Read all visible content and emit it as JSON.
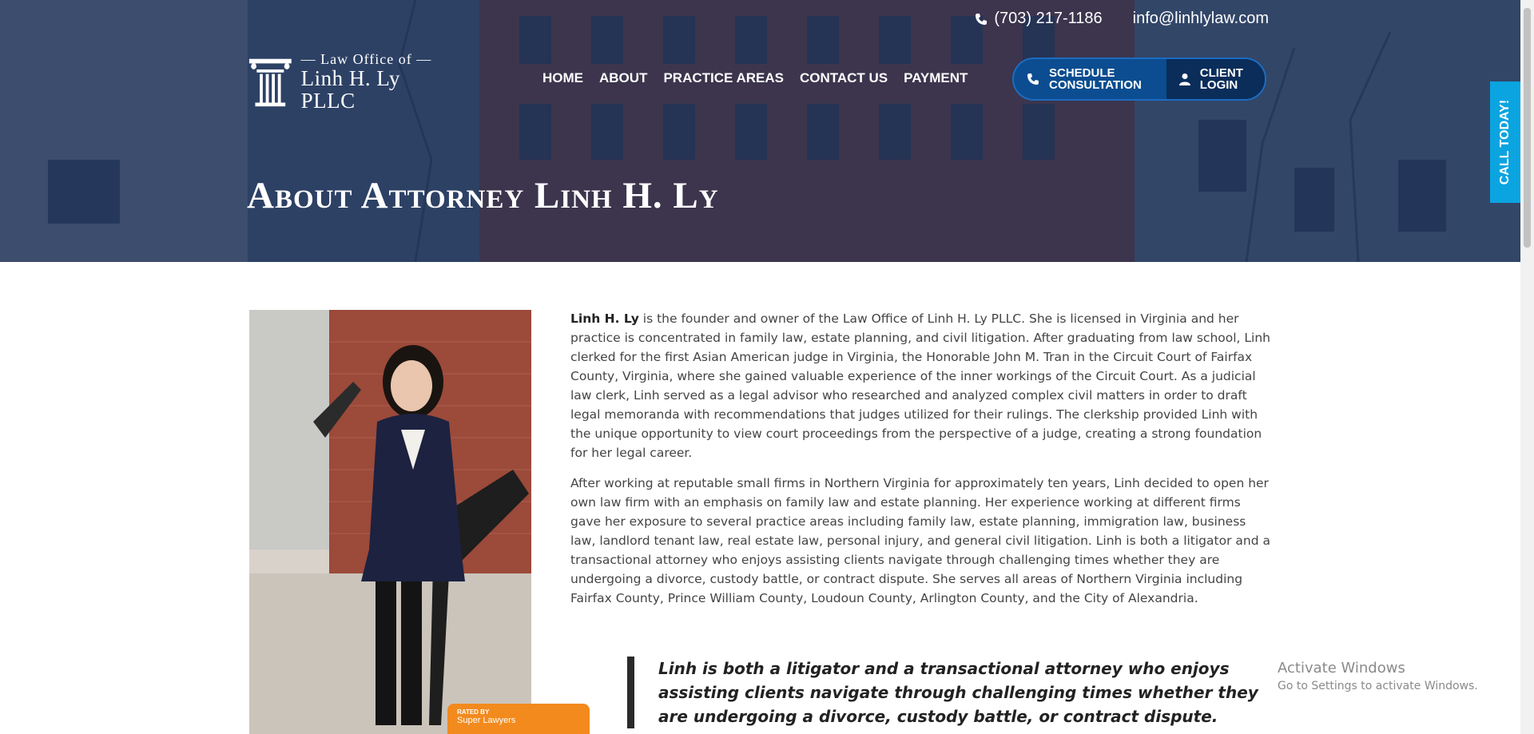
{
  "contact": {
    "phone": "(703) 217-1186",
    "email": "info@linhlylaw.com"
  },
  "logo": {
    "line1": "— Law Office of —",
    "line2": "Linh H. Ly PLLC"
  },
  "nav": {
    "items": [
      "HOME",
      "ABOUT",
      "PRACTICE AREAS",
      "CONTACT US",
      "PAYMENT"
    ]
  },
  "cta": {
    "schedule_line1": "SCHEDULE",
    "schedule_line2": "CONSULTATION",
    "client_line1": "CLIENT",
    "client_line2": "LOGIN"
  },
  "hero": {
    "title": "About Attorney Linh H. Ly"
  },
  "side_tab": {
    "label": "CALL TODAY!"
  },
  "bio": {
    "name": "Linh H. Ly",
    "p1_rest": " is the founder and owner of the Law Office of Linh H. Ly PLLC. She is licensed in Virginia and her practice is concentrated in family law, estate planning, and civil litigation. After graduating from law school, Linh clerked for the first Asian American judge in Virginia, the Honorable John M. Tran in the Circuit Court of Fairfax County, Virginia, where she gained valuable experience of the inner workings of the Circuit Court. As a judicial law clerk, Linh served as a legal advisor who researched and analyzed complex civil matters in order to draft legal memoranda with recommendations that judges utilized for their rulings. The clerkship provided Linh with the unique opportunity to view court proceedings from the perspective of a judge, creating a strong foundation for her legal career.",
    "p2": "After working at reputable small firms in Northern Virginia for approximately ten years, Linh decided to open her own law firm with an emphasis on family law and estate planning. Her experience working at different firms gave her exposure to several practice areas including family law, estate planning, immigration law, business law, landlord tenant law, real estate law, personal injury, and general civil litigation. Linh is both a litigator and a transactional attorney who enjoys assisting clients navigate through challenging times whether they are undergoing a divorce, custody battle, or contract dispute. She serves all areas of Northern Virginia including Fairfax County, Prince William County, Loudoun County, Arlington County, and the City of Alexandria.",
    "quote": "Linh is both a litigator and a transactional attorney who enjoys assisting clients navigate through challenging times whether they are undergoing a divorce, custody battle, or contract dispute."
  },
  "badge": {
    "small": "RATED BY",
    "name": "Super Lawyers"
  },
  "watermark": {
    "title": "Activate Windows",
    "subtitle": "Go to Settings to activate Windows."
  },
  "colors": {
    "hero_overlay": "#16305a",
    "cta_blue": "#0b4d90",
    "cta_dark": "#0a2d5a",
    "call_tab": "#0aa4e1",
    "badge": "#f28a1e"
  }
}
